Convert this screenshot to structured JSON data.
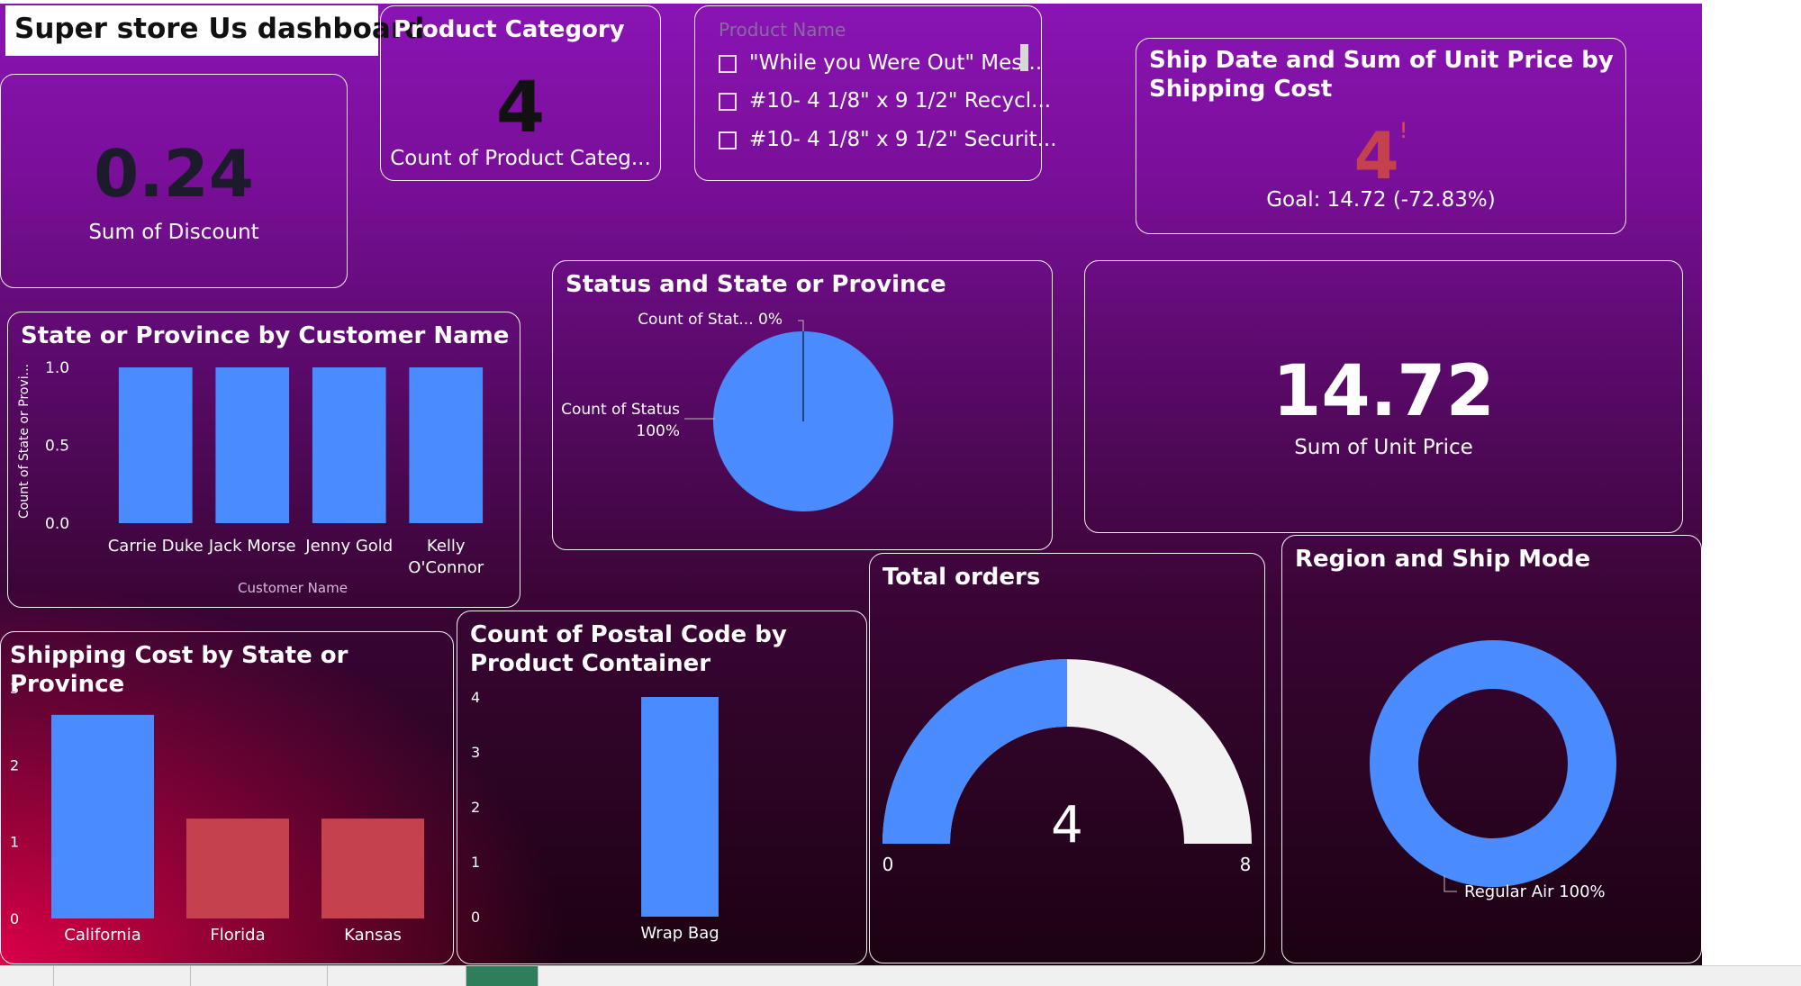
{
  "dashboard_title": "Super store Us dashboard",
  "colors": {
    "accent_blue": "#4a8bff",
    "accent_red": "#c5414d",
    "kpi_red": "#e84b4b",
    "gauge_bg": "#f2f2f2"
  },
  "kpi_discount": {
    "value": "0.24",
    "label": "Sum of Discount"
  },
  "kpi_category": {
    "title": "Product Category",
    "value": "4",
    "label": "Count of Product Categ..."
  },
  "slicer": {
    "header": "Product Name",
    "items": [
      "\"While you Were Out\" Mes...",
      "#10- 4 1/8\" x 9 1/2\" Recycl...",
      "#10- 4 1/8\" x 9 1/2\" Securit..."
    ]
  },
  "kpi_ship": {
    "title": "Ship Date and Sum of Unit Price by Shipping Cost",
    "value": "4",
    "indicator": "!",
    "goal": "Goal: 14.72 (-72.83%)"
  },
  "kpi_unit_price": {
    "value": "14.72",
    "label": "Sum of Unit Price"
  },
  "chart_data": [
    {
      "type": "bar",
      "title": "State or Province by Customer Name",
      "xlabel": "Customer Name",
      "ylabel": "Count of State or Provi...",
      "categories": [
        "Carrie Duke",
        "Jack Morse",
        "Jenny Gold",
        "Kelly O'Connor"
      ],
      "category_lines": [
        [
          "Carrie Duke"
        ],
        [
          "Jack Morse"
        ],
        [
          "Jenny Gold"
        ],
        [
          "Kelly",
          "O'Connor"
        ]
      ],
      "values": [
        1,
        1,
        1,
        1
      ],
      "yticks": [
        "0.0",
        "0.5",
        "1.0"
      ],
      "ylim": [
        0,
        1
      ],
      "grid": false
    },
    {
      "type": "pie",
      "title": "Status and State or Province",
      "slices": [
        {
          "label": "Count of Stat...",
          "percent_label": "0%",
          "value": 0
        },
        {
          "label": "Count of Status",
          "percent_label": "100%",
          "value": 100
        }
      ]
    },
    {
      "type": "bar",
      "title": "Shipping Cost by State or Province",
      "categories": [
        "California",
        "Florida",
        "Kansas"
      ],
      "values": [
        2.65,
        1.3,
        1.3
      ],
      "bar_colors": [
        "#4a8bff",
        "#c5414d",
        "#c5414d"
      ],
      "yticks": [
        "0",
        "1",
        "2",
        "3"
      ],
      "ylim": [
        0,
        3
      ],
      "grid": false
    },
    {
      "type": "bar",
      "title": "Count of Postal Code by Product Container",
      "categories": [
        "Wrap Bag"
      ],
      "values": [
        4
      ],
      "yticks": [
        "0",
        "1",
        "2",
        "3",
        "4"
      ],
      "ylim": [
        0,
        4
      ],
      "grid": false
    },
    {
      "type": "gauge",
      "title": "Total orders",
      "value": 4,
      "value_label": "4",
      "min": 0,
      "max": 8,
      "min_label": "0",
      "max_label": "8"
    },
    {
      "type": "donut",
      "title": "Region and Ship Mode",
      "slices": [
        {
          "label": "Regular Air 100%",
          "value": 100
        }
      ]
    }
  ]
}
